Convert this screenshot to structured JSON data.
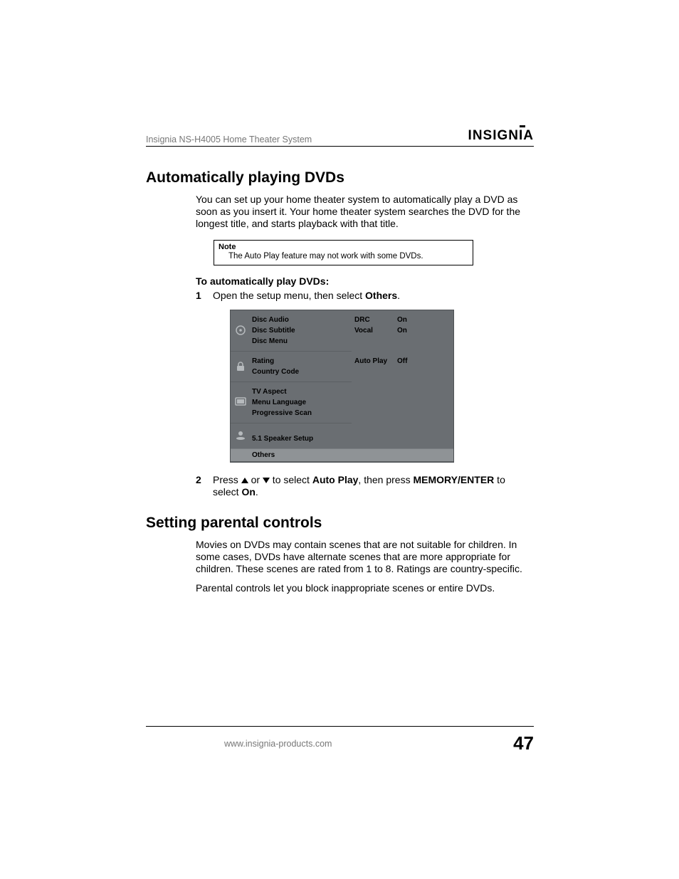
{
  "header": {
    "product": "Insignia NS-H4005 Home Theater System",
    "brand": "INSIGNIA"
  },
  "section1": {
    "title": "Automatically playing DVDs",
    "intro": "You can set up your home theater system to automatically play a DVD as soon as you insert it. Your home theater system searches the DVD for the longest title, and starts playback with that title.",
    "note_label": "Note",
    "note_text": "The Auto Play feature may not work with some DVDs.",
    "subhead": "To automatically play DVDs:",
    "step1_num": "1",
    "step1_a": "Open the setup menu, then select ",
    "step1_b": "Others",
    "step1_c": ".",
    "step2_num": "2",
    "step2_a": "Press ",
    "step2_b": " or ",
    "step2_c": " to select ",
    "step2_d": "Auto Play",
    "step2_e": ", then press ",
    "step2_f": "MEMORY/ENTER",
    "step2_g": " to select ",
    "step2_h": "On",
    "step2_i": "."
  },
  "osd": {
    "group1": {
      "items": [
        "Disc Audio",
        "Disc Subtitle",
        "Disc Menu"
      ]
    },
    "group2": {
      "items": [
        "Rating",
        "Country Code"
      ]
    },
    "group3": {
      "items": [
        "TV Aspect",
        "Menu Language",
        "Progressive Scan"
      ]
    },
    "group4": {
      "items": [
        "5.1 Speaker Setup"
      ]
    },
    "selected": "Others",
    "right1": [
      {
        "k": "DRC",
        "v": "On"
      },
      {
        "k": "Vocal",
        "v": "On"
      }
    ],
    "right2": [
      {
        "k": "Auto Play",
        "v": "Off"
      }
    ]
  },
  "section2": {
    "title": "Setting parental controls",
    "p1": "Movies on DVDs may contain scenes that are not suitable for children. In some cases, DVDs have alternate scenes that are more appropriate for children. These scenes are rated from 1 to 8. Ratings are country-specific.",
    "p2": "Parental controls let you block inappropriate scenes or entire DVDs."
  },
  "footer": {
    "url": "www.insignia-products.com",
    "page": "47"
  }
}
